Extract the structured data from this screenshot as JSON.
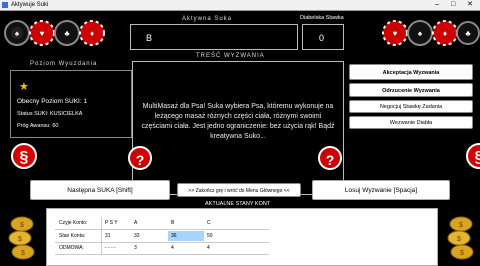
{
  "window": {
    "title": "Aktywuje Suki",
    "controls": "– □ ✕"
  },
  "suka": {
    "label": "Aktywna Suka",
    "value": "B"
  },
  "stawka": {
    "label": "Diabelska Stawka",
    "value": "0"
  },
  "tresc": {
    "label": "TREŚĆ WYZWANIA",
    "text": "MultiMasaż dla Psa! Suka wybiera Psa, któremu wykonuje na leżącego masaż różnych części ciała, różnymi swoimi częściami ciała. Jest jedno ograniczenie: bez użycia rąk! Bądź kreatywna Suko..."
  },
  "poziom": {
    "label": "Poziom Wyuzdania",
    "star": "★",
    "obecny": "Obecny Poziom SUKI: 1",
    "status": "Status SUKI: KUSICIELKA",
    "prog": "Próg Awansu: 60"
  },
  "actions": {
    "akceptacja": "Akceptacja Wyzwania",
    "odrzucenie": "Odrzucenie Wyzwania",
    "negocjuj": "Negocjuj Stawkę Zadania",
    "diabla": "Wezwanie Diabła"
  },
  "symbols": {
    "paragraph": "§",
    "question": "?"
  },
  "bottom": {
    "next": "Następna SUKA [Shift]",
    "exit": ">> Zakończ grę i wróć do Menu Głównego <<",
    "random": "Losuj Wyzwanie [Spacja]"
  },
  "table": {
    "title": "AKTUALNE STANY KONT",
    "header": [
      "Czyje Konto:",
      "P S Y",
      "A",
      "B",
      "C"
    ],
    "rows": [
      [
        "Stan Konta:",
        "31",
        "33",
        "36",
        "50"
      ],
      [
        "ODMOWA:",
        "- - - -",
        "3",
        "4",
        "4"
      ]
    ]
  },
  "colors": {
    "accent_red": "#d40000",
    "highlight_cell": "#a6d4ff",
    "gold": "#d9a520"
  }
}
